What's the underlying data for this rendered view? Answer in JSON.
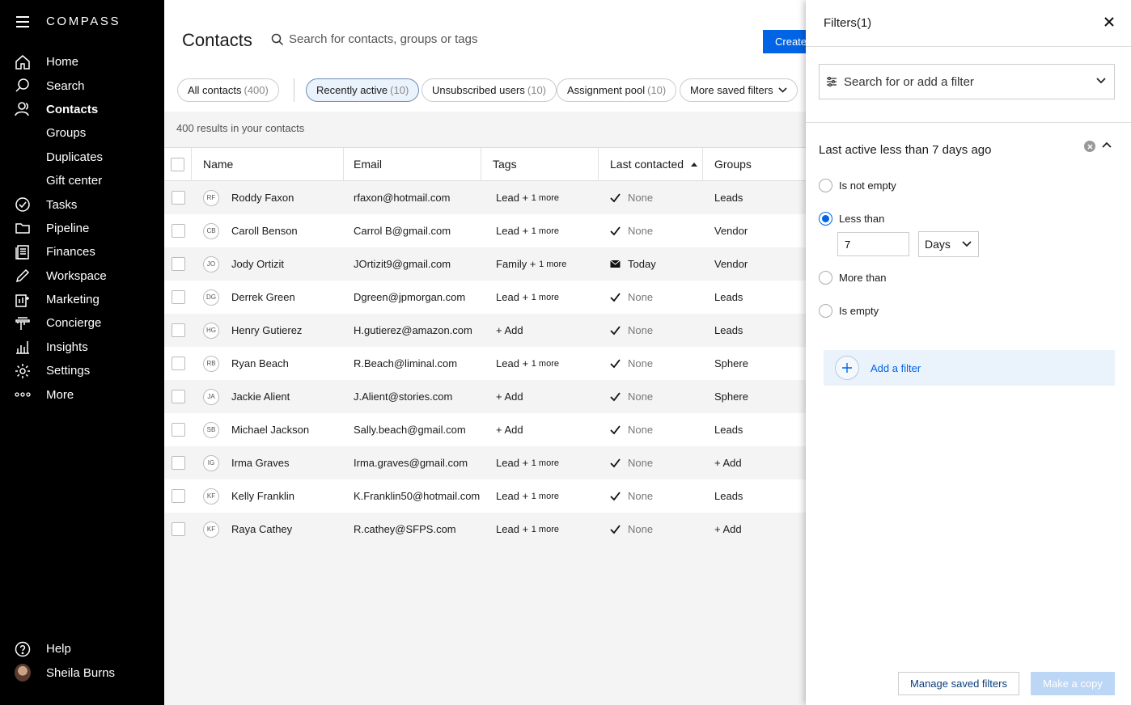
{
  "sidebar": {
    "logo": "COMPASS",
    "items": [
      {
        "label": "Home",
        "icon": "home-icon"
      },
      {
        "label": "Search",
        "icon": "search-icon"
      },
      {
        "label": "Contacts",
        "icon": "contacts-icon"
      },
      {
        "label": "Groups"
      },
      {
        "label": "Duplicates"
      },
      {
        "label": "Gift center"
      },
      {
        "label": "Tasks",
        "icon": "check-circle-icon"
      },
      {
        "label": "Pipeline",
        "icon": "folder-icon"
      },
      {
        "label": "Finances",
        "icon": "finances-icon"
      },
      {
        "label": "Workspace",
        "icon": "pen-icon"
      },
      {
        "label": "Marketing",
        "icon": "marketing-icon"
      },
      {
        "label": "Concierge",
        "icon": "concierge-icon"
      },
      {
        "label": "Insights",
        "icon": "bar-chart-icon"
      },
      {
        "label": "Settings",
        "icon": "gear-icon"
      },
      {
        "label": "More",
        "icon": "more-dots-icon"
      }
    ],
    "help": "Help",
    "user": "Sheila Burns"
  },
  "header": {
    "title": "Contacts",
    "search_placeholder": "Search for contacts, groups or tags",
    "create_label": "Create"
  },
  "chips": [
    {
      "label": "All contacts",
      "count": "(400)"
    },
    {
      "label": "Recently active",
      "count": "(10)"
    },
    {
      "label": "Unsubscribed users",
      "count": "(10)"
    },
    {
      "label": "Assignment pool",
      "count": "(10)"
    },
    {
      "label": "More saved filters",
      "count": ""
    }
  ],
  "results_text": "400 results in your contacts",
  "table": {
    "columns": [
      "Name",
      "Email",
      "Tags",
      "Last contacted",
      "Groups"
    ],
    "rows": [
      {
        "initials": "RF",
        "name": "Roddy Faxon",
        "email": "rfaxon@hotmail.com",
        "tag": "Lead + ",
        "tag_more": "1 more",
        "last": "None",
        "group": "Leads"
      },
      {
        "initials": "CB",
        "name": "Caroll Benson",
        "email": "Carrol B@gmail.com",
        "tag": "Lead + ",
        "tag_more": "1 more",
        "last": "None",
        "group": "Vendor"
      },
      {
        "initials": "JO",
        "name": "Jody Ortizit",
        "email": "JOrtizit9@gmail.com",
        "tag": "Family + ",
        "tag_more": "1 more",
        "last": "Today",
        "group": "Vendor"
      },
      {
        "initials": "DG",
        "name": "Derrek Green",
        "email": "Dgreen@jpmorgan.com",
        "tag": "Lead + ",
        "tag_more": "1 more",
        "last": "None",
        "group": "Leads"
      },
      {
        "initials": "HG",
        "name": "Henry Gutierez",
        "email": "H.gutierez@amazon.com",
        "tag": "+ Add",
        "tag_more": "",
        "last": "None",
        "group": "Leads"
      },
      {
        "initials": "RB",
        "name": "Ryan Beach",
        "email": "R.Beach@liminal.com",
        "tag": "Lead + ",
        "tag_more": "1 more",
        "last": "None",
        "group": "Sphere"
      },
      {
        "initials": "JA",
        "name": "Jackie Alient",
        "email": "J.Alient@stories.com",
        "tag": "+ Add",
        "tag_more": "",
        "last": "None",
        "group": "Sphere"
      },
      {
        "initials": "SB",
        "name": "Michael Jackson",
        "email": "Sally.beach@gmail.com",
        "tag": "+ Add",
        "tag_more": "",
        "last": "None",
        "group": "Leads"
      },
      {
        "initials": "IG",
        "name": "Irma Graves",
        "email": "Irma.graves@gmail.com",
        "tag": "Lead + ",
        "tag_more": "1 more",
        "last": "None",
        "group": "+ Add"
      },
      {
        "initials": "KF",
        "name": "Kelly Franklin",
        "email": "K.Franklin50@hotmail.com",
        "tag": "Lead + ",
        "tag_more": "1 more",
        "last": "None",
        "group": "Leads"
      },
      {
        "initials": "KF",
        "name": "Raya Cathey",
        "email": "R.cathey@SFPS.com",
        "tag": "Lead + ",
        "tag_more": "1 more",
        "last": "None",
        "group": "+ Add"
      }
    ]
  },
  "filters": {
    "title": "Filters(1)",
    "search_label": "Search for or add a filter",
    "section_title": "Last active less than 7 days ago",
    "options": [
      "Is not empty",
      "Less than",
      "More than",
      "Is empty"
    ],
    "selected_option": "Less than",
    "value": "7",
    "unit": "Days",
    "add_filter": "Add a filter",
    "manage_label": "Manage saved filters",
    "copy_label": "Make a copy"
  },
  "colors": {
    "accent": "#0064e5",
    "sidebar_bg": "#000000",
    "chip_selected_bg": "#eaf2fb"
  }
}
